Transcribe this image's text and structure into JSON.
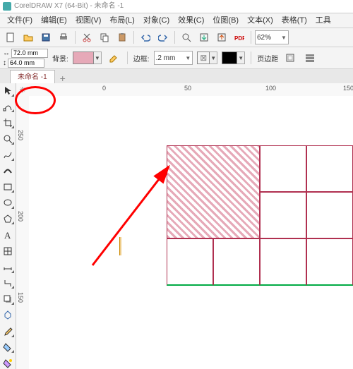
{
  "title": "CorelDRAW X7 (64-Bit) - 未命名 -1",
  "menu": [
    "文件(F)",
    "编辑(E)",
    "视图(V)",
    "布局(L)",
    "对象(C)",
    "效果(C)",
    "位图(B)",
    "文本(X)",
    "表格(T)",
    "工具"
  ],
  "zoom": "62%",
  "dims": {
    "w": "72.0 mm",
    "h": "64.0 mm"
  },
  "prop": {
    "bg_label": "背景:",
    "border_label": "边框:",
    "border_val": ".2 mm",
    "margin_label": "页边距"
  },
  "tab": "未命名 -1",
  "ruler": {
    "h": [
      "0",
      "50",
      "100",
      "150"
    ],
    "v": [
      "250",
      "200",
      "150"
    ]
  }
}
